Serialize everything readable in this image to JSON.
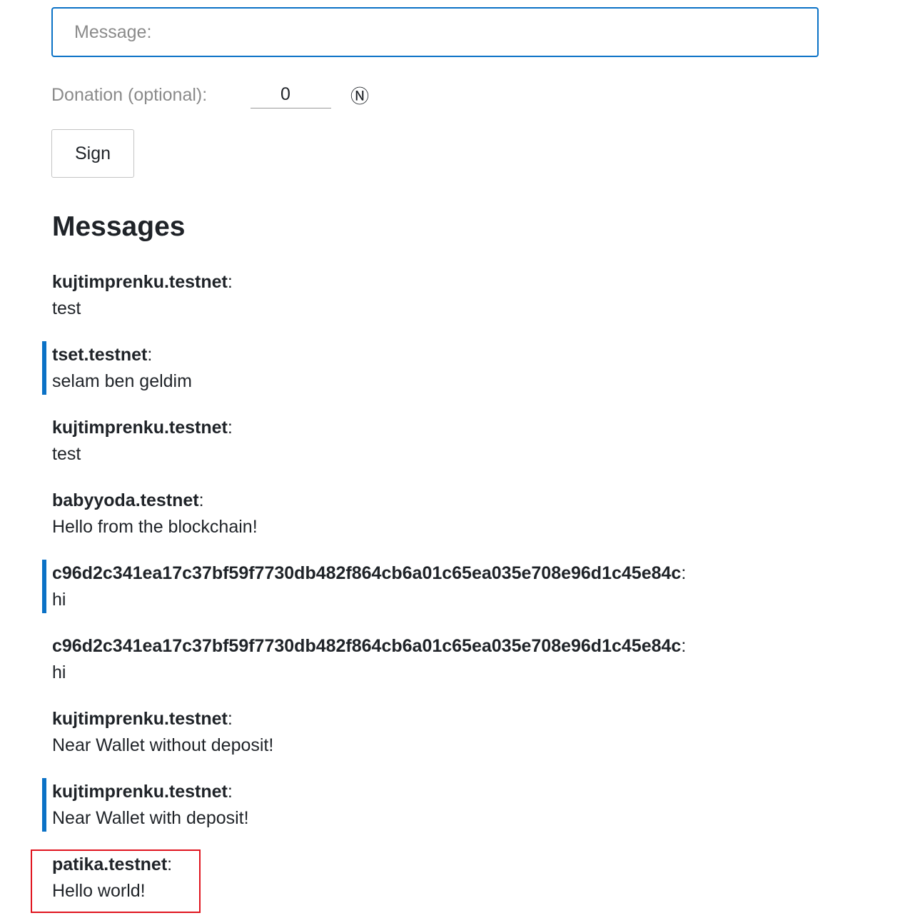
{
  "form": {
    "message_label": "Message:",
    "message_value": "",
    "donation_label": "Donation (optional):",
    "donation_value": "0",
    "currency_symbol": "Ⓝ",
    "sign_label": "Sign"
  },
  "messages_title": "Messages",
  "separator": ":",
  "messages": [
    {
      "sender": "kujtimprenku.testnet",
      "text": "test",
      "premium": false
    },
    {
      "sender": "tset.testnet",
      "text": "selam ben geldim",
      "premium": true
    },
    {
      "sender": "kujtimprenku.testnet",
      "text": "test",
      "premium": false
    },
    {
      "sender": "babyyoda.testnet",
      "text": "Hello from the blockchain!",
      "premium": false
    },
    {
      "sender": "c96d2c341ea17c37bf59f7730db482f864cb6a01c65ea035e708e96d1c45e84c",
      "text": "hi",
      "premium": true
    },
    {
      "sender": "c96d2c341ea17c37bf59f7730db482f864cb6a01c65ea035e708e96d1c45e84c",
      "text": "hi",
      "premium": false
    },
    {
      "sender": "kujtimprenku.testnet",
      "text": "Near Wallet without deposit!",
      "premium": false
    },
    {
      "sender": "kujtimprenku.testnet",
      "text": "Near Wallet with deposit!",
      "premium": true
    },
    {
      "sender": "patika.testnet",
      "text": "Hello world!",
      "premium": false,
      "highlighted": true
    }
  ],
  "colors": {
    "accent": "#0b72c6",
    "highlight_border": "#e0141e",
    "label_gray": "#8a8a8a",
    "text": "#1f2328"
  }
}
